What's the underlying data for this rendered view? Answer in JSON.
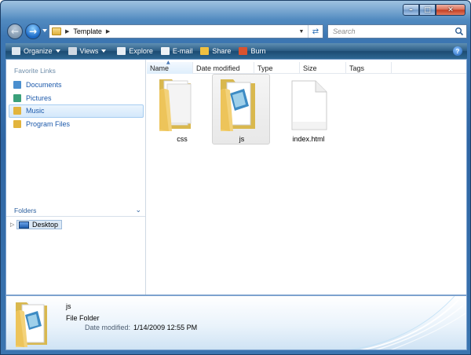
{
  "window": {
    "caption_buttons": {
      "minimize": "–",
      "maximize": "□",
      "close": "✕"
    }
  },
  "navigation": {
    "back_icon": "back-arrow-icon",
    "forward_icon": "forward-arrow-icon",
    "address": {
      "location": "Template"
    },
    "search": {
      "placeholder": "Search"
    }
  },
  "command_bar": {
    "items": [
      {
        "label": "Organize",
        "icon": "organize-icon",
        "has_dropdown": true,
        "color": "#dfe7ef"
      },
      {
        "label": "Views",
        "icon": "views-icon",
        "has_dropdown": true,
        "color": "#cfd8e2"
      },
      {
        "label": "Explore",
        "icon": "explore-icon",
        "has_dropdown": false,
        "color": "#e8eef5"
      },
      {
        "label": "E-mail",
        "icon": "email-icon",
        "has_dropdown": false,
        "color": "#eef2f6"
      },
      {
        "label": "Share",
        "icon": "share-icon",
        "has_dropdown": false,
        "color": "#f0c040"
      },
      {
        "label": "Burn",
        "icon": "burn-icon",
        "has_dropdown": false,
        "color": "#d9532f"
      }
    ],
    "help": "?"
  },
  "navigation_pane": {
    "favorites_heading": "Favorite Links",
    "favorites": [
      {
        "label": "Documents",
        "icon": "documents-icon",
        "color": "#4a8fcf",
        "selected": false
      },
      {
        "label": "Pictures",
        "icon": "pictures-icon",
        "color": "#3aa07a",
        "selected": false
      },
      {
        "label": "Music",
        "icon": "music-icon",
        "color": "#e2b43d",
        "selected": true
      },
      {
        "label": "Program Files",
        "icon": "folder-icon",
        "color": "#e2b43d",
        "selected": false
      }
    ],
    "folders_heading": "Folders",
    "tree": [
      {
        "label": "Desktop",
        "icon": "desktop-icon",
        "expander": "▷"
      }
    ]
  },
  "file_list": {
    "columns": [
      "Name",
      "Date modified",
      "Type",
      "Size",
      "Tags"
    ],
    "sorted_column": "Name",
    "items": [
      {
        "name": "css",
        "kind": "folder",
        "selected": false
      },
      {
        "name": "js",
        "kind": "folder",
        "selected": true
      },
      {
        "name": "index.html",
        "kind": "file",
        "selected": false
      }
    ]
  },
  "details_pane": {
    "name": "js",
    "type": "File Folder",
    "modified_label": "Date modified:",
    "modified_value": "1/14/2009 12:55 PM"
  }
}
